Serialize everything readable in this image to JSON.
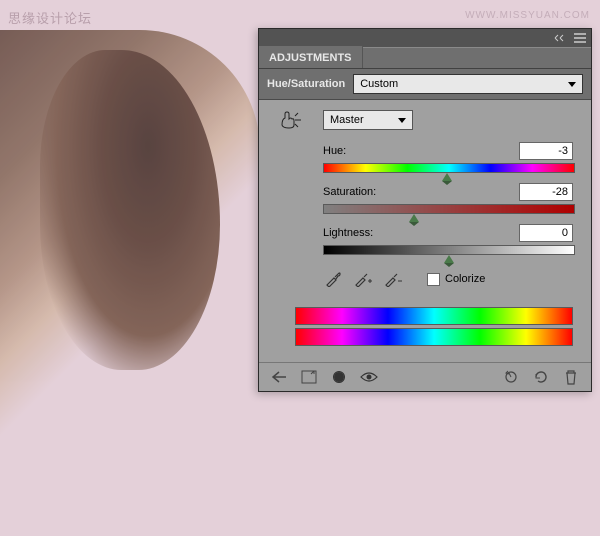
{
  "watermark": {
    "left": "思缘设计论坛",
    "right": "WWW.MISSYUAN.COM"
  },
  "panel": {
    "tab": "ADJUSTMENTS",
    "adjustment": "Hue/Saturation",
    "preset": "Custom",
    "channel": "Master",
    "sliders": {
      "hue": {
        "label": "Hue:",
        "value": "-3",
        "pos": 49
      },
      "saturation": {
        "label": "Saturation:",
        "value": "-28",
        "pos": 36
      },
      "lightness": {
        "label": "Lightness:",
        "value": "0",
        "pos": 50
      }
    },
    "colorize": "Colorize"
  }
}
